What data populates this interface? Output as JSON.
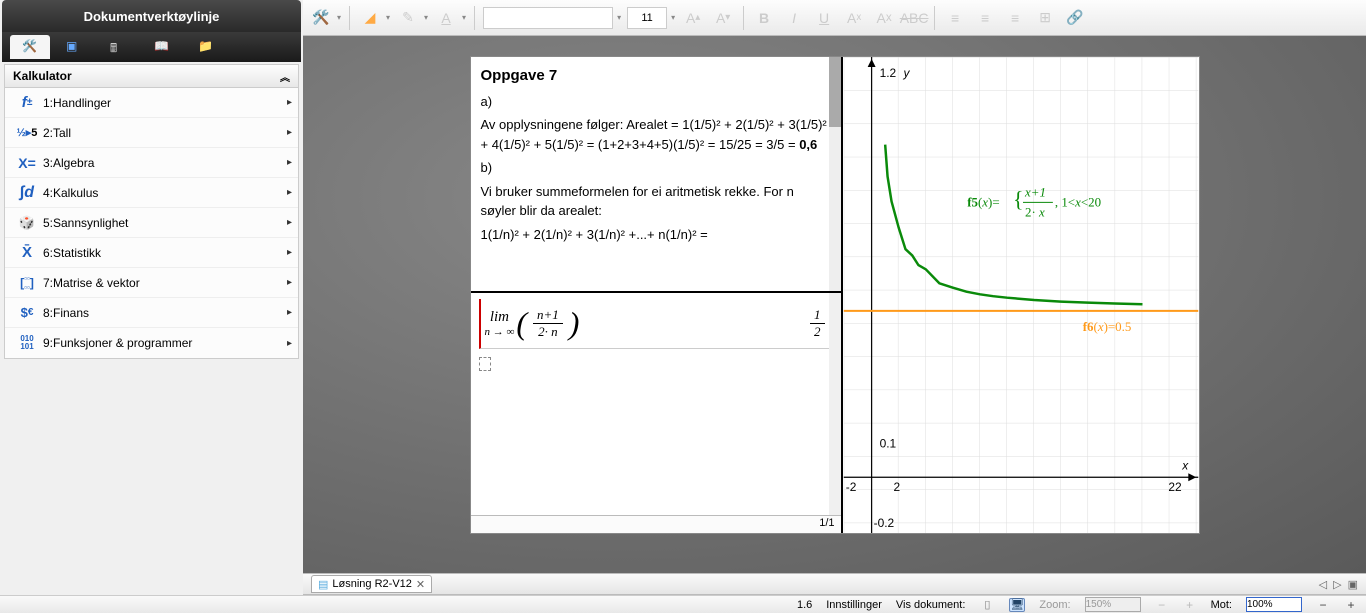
{
  "panel": {
    "title": "Dokumentverktøylinje",
    "section_title": "Kalkulator",
    "items": [
      {
        "icon": "f±",
        "label": "1:Handlinger"
      },
      {
        "icon": "½▸5",
        "label": "2:Tall"
      },
      {
        "icon": "X=",
        "label": "3:Algebra"
      },
      {
        "icon": "∫d",
        "label": "4:Kalkulus"
      },
      {
        "icon": "🎲",
        "label": "5:Sannsynlighet"
      },
      {
        "icon": "X̄",
        "label": "6:Statistikk"
      },
      {
        "icon": "[∷]",
        "label": "7:Matrise & vektor"
      },
      {
        "icon": "$€",
        "label": "8:Finans"
      },
      {
        "icon": "010\n101",
        "label": "9:Funksjoner & programmer"
      }
    ]
  },
  "toolbar": {
    "font_name": "",
    "font_size": "11"
  },
  "notes": {
    "title": "Oppgave 7",
    "part_a": "a)",
    "line_a1": "Av opplysningene følger: Arealet = 1(1/5)² + 2(1/5)² + 3(1/5)² + 4(1/5)² + 5(1/5)² = (1+2+3+4+5)(1/5)² = 15/25 = 3/5 = ",
    "bold_a": "0,6",
    "part_b": "b)",
    "line_b1": "Vi bruker summeformelen for ei aritmetisk rekke. For n søyler blir da arealet:",
    "line_b2": "1(1/n)² + 2(1/n)² + 3(1/n)² +...+ n(1/n)² ="
  },
  "math": {
    "lim_label": "lim",
    "lim_sub": "n → ∞",
    "frac_num": "n+1",
    "frac_den": "2· n",
    "result_num": "1",
    "result_den": "2"
  },
  "page_counter": "1/1",
  "graph": {
    "y_label": "y",
    "x_label": "x",
    "y_max": "1.2",
    "y_mid": "0.1",
    "y_min": "-0.2",
    "x_min": "-2",
    "x_tick": "2",
    "x_max": "22",
    "f5_label_pre": "f5",
    "f5_label_post": "(x)=",
    "f5_frac_num": "x+1",
    "f5_frac_den": "2· x",
    "f5_cond": ", 1<x<20",
    "f6_label_pre": "f6",
    "f6_label_post": "(x)=0.5"
  },
  "chart_data": {
    "type": "line",
    "title": "",
    "xlabel": "x",
    "ylabel": "y",
    "xlim": [
      -2,
      22
    ],
    "ylim": [
      -0.2,
      1.2
    ],
    "series": [
      {
        "name": "f5(x)=(x+1)/(2x), 1<x<20",
        "formula": "(x+1)/(2*x)",
        "domain": [
          1,
          20
        ],
        "sample": [
          [
            1,
            1.0
          ],
          [
            2,
            0.75
          ],
          [
            3,
            0.667
          ],
          [
            4,
            0.625
          ],
          [
            5,
            0.6
          ],
          [
            6,
            0.583
          ],
          [
            8,
            0.5625
          ],
          [
            10,
            0.55
          ],
          [
            12,
            0.542
          ],
          [
            15,
            0.533
          ],
          [
            18,
            0.528
          ],
          [
            20,
            0.525
          ]
        ],
        "color": "#0a8a0a"
      },
      {
        "name": "f6(x)=0.5",
        "formula": "0.5",
        "domain": [
          -2,
          22
        ],
        "sample": [
          [
            -2,
            0.5
          ],
          [
            22,
            0.5
          ]
        ],
        "color": "#ff9a1a"
      }
    ],
    "xticks": [
      -2,
      2,
      22
    ],
    "yticks": [
      -0.2,
      0.1,
      1.2
    ]
  },
  "doc_tab": {
    "name": "Løsning R2-V12"
  },
  "status": {
    "page_pos": "1.6",
    "settings": "Innstillinger",
    "vis_dokument": "Vis dokument:",
    "zoom_label": "Zoom:",
    "zoom_val": "150%",
    "mot_label": "Mot:",
    "mot_val": "100%"
  }
}
